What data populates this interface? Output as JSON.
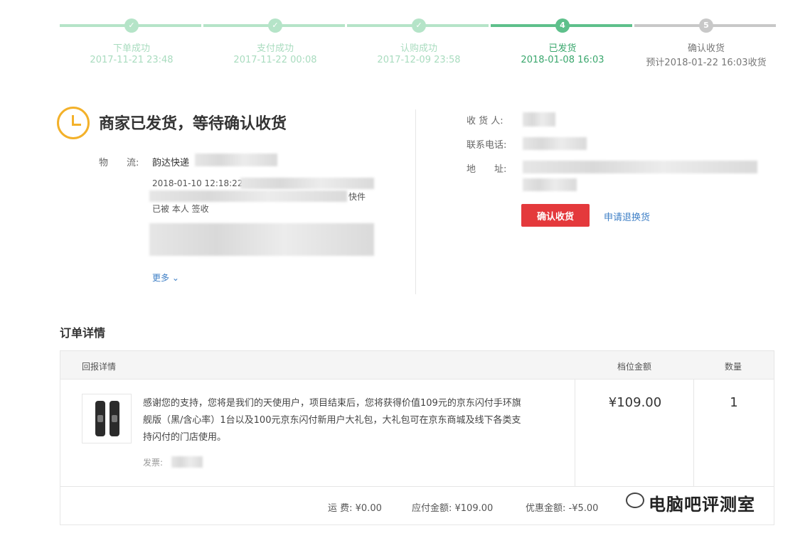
{
  "progress": {
    "steps": [
      {
        "num": "✓",
        "label": "下单成功",
        "time": "2017-11-21 23:48"
      },
      {
        "num": "✓",
        "label": "支付成功",
        "time": "2017-11-22 00:08"
      },
      {
        "num": "✓",
        "label": "认购成功",
        "time": "2017-12-09 23:58"
      },
      {
        "num": "4",
        "label": "已发货",
        "time": "2018-01-08 16:03"
      },
      {
        "num": "5",
        "label": "确认收货",
        "time": "预计2018-01-22 16:03收货"
      }
    ]
  },
  "status": {
    "title": "商家已发货，等待确认收货",
    "logistics_label": "物　　流:",
    "courier": "韵达快递",
    "track_time": "2018-01-10 12:18:22",
    "track_suffix": "快件",
    "signed": "已被 本人 签收",
    "more": "更多"
  },
  "receiver": {
    "name_label": "收 货 人:",
    "phone_label": "联系电话:",
    "address_label": "地　　址:",
    "confirm_button": "确认收货",
    "refund_link": "申请退换货"
  },
  "order": {
    "section_title": "订单详情",
    "headers": {
      "detail": "回报详情",
      "price": "档位金额",
      "qty": "数量"
    },
    "description": "感谢您的支持，您将是我们的天使用户，项目结束后，您将获得价值109元的京东闪付手环旗舰版（黑/含心率）1台以及100元京东闪付新用户大礼包，大礼包可在京东商城及线下各类支持闪付的门店使用。",
    "invoice_label": "发票:",
    "price": "¥109.00",
    "qty": "1",
    "shipping": "运 费: ¥0.00",
    "payable": "应付金额: ¥109.00",
    "discount": "优惠金额: -¥5.00"
  },
  "watermark": "电脑吧评测室",
  "colors": {
    "done": "#b5e4c8",
    "current": "#5ec08b",
    "todo": "#c8c8c8",
    "accent": "#e4393c",
    "link": "#3e7fc6",
    "clock": "#f3b12a"
  }
}
